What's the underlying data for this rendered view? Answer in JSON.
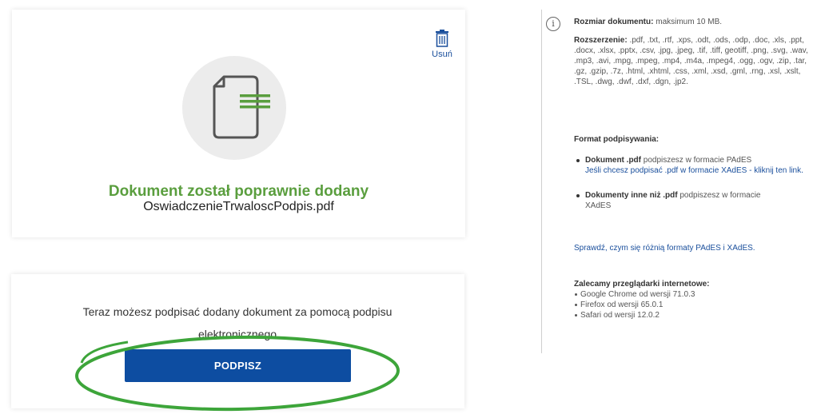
{
  "upload": {
    "delete_label": "Usuń",
    "success_title": "Dokument został poprawnie dodany",
    "filename": "OswiadczenieTrwaloscPodpis.pdf"
  },
  "sign": {
    "text": "Teraz możesz podpisać dodany dokument za pomocą podpisu elektronicznego",
    "button_label": "PODPISZ",
    "highlight_color": "#3da53a"
  },
  "info": {
    "size_label": "Rozmiar dokumentu:",
    "size_value": "maksimum 10 MB.",
    "ext_label": "Rozszerzenie:",
    "ext_value": ".pdf, .txt, .rtf, .xps, .odt, .ods, .odp, .doc, .xls, .ppt, .docx, .xlsx, .pptx, .csv, .jpg, .jpeg, .tif, .tiff, geotiff, .png, .svg, .wav, .mp3, .avi, .mpg, .mpeg, .mp4, .m4a, .mpeg4, .ogg, .ogv, .zip, .tar, .gz, .gzip, .7z, .html, .xhtml, .css, .xml, .xsd, .gml, .rng, .xsl, .xslt, .TSL, .dwg, .dwf, .dxf, .dgn, .jp2.",
    "format_title": "Format podpisywania:",
    "pdf_bold": "Dokument .pdf",
    "pdf_text": "podpiszesz w formacie PAdES",
    "xades_link": "Jeśli chcesz podpisać .pdf w formacie XAdES - kliknij ten link.",
    "other_bold": "Dokumenty inne niż .pdf",
    "other_text": "podpiszesz w formacie XAdES",
    "diff_link": "Sprawdź, czym się różnią formaty PAdES i XAdES.",
    "browsers_title": "Zalecamy przeglądarki internetowe:",
    "browsers": [
      "Google Chrome od wersji 71.0.3",
      "Firefox od wersji 65.0.1",
      "Safari od wersji 12.0.2"
    ]
  }
}
